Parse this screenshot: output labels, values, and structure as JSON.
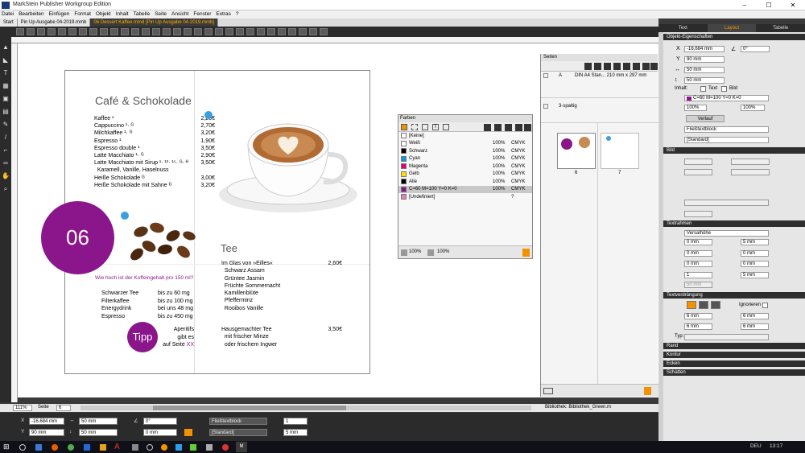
{
  "app": {
    "title": "MarkStein Publisher Workgroup Edition"
  },
  "menu": [
    "Datei",
    "Bearbeiten",
    "Einfügen",
    "Format",
    "Objekt",
    "Inhalt",
    "Tabelle",
    "Seite",
    "Ansicht",
    "Fenster",
    "Extras",
    "?"
  ],
  "tabs": [
    "Start",
    "Pin Up Ausgabe 04-2019.mmb",
    "06 Dessert Kaffee.mmd [Pin Up Ausgabe 04-2019.mmb]"
  ],
  "page": {
    "title": "Café & Schokolade",
    "coffee_items": [
      {
        "name": "Kaffee ¹",
        "price": "2,20€"
      },
      {
        "name": "Cappuccino ¹· ᴳ",
        "price": "2,70€"
      },
      {
        "name": "Milchkaffee ¹· ᴳ",
        "price": "3,20€"
      },
      {
        "name": "Espresso ¹",
        "price": "1,90€"
      },
      {
        "name": "Espresso double ¹",
        "price": "3,50€"
      },
      {
        "name": "Latte Macchiato ¹· ᴳ",
        "price": "2,90€"
      },
      {
        "name": "Latte Macchiato mit Sirup ¹· ¹³· ¹⁵· ᴳ· ᴴ",
        "price": "3,50€"
      },
      {
        "name": "  Karamell, Vanille, Haselnuss",
        "price": ""
      },
      {
        "name": "Heiße Schokolade ᴳ",
        "price": "3,00€"
      },
      {
        "name": "Heiße Schokolade mit Sahne ᴳ",
        "price": "3,20€"
      }
    ],
    "badge_number": "06",
    "caffeine_question": "Wie hoch ist der Koffeingehalt pro 150 ml?",
    "caffeine": [
      {
        "name": "Schwarzer Tee",
        "value": "bis zu 60 mg"
      },
      {
        "name": "Filterkaffee",
        "value": "bis zu 100 mg"
      },
      {
        "name": "Energydrink",
        "value": "bei uns 48 mg"
      },
      {
        "name": "Espresso",
        "value": "bis zu 450 mg"
      }
    ],
    "tipp": "Tipp",
    "tipp_text": [
      "Aperitifs",
      "gibt es",
      "auf Seite XX"
    ],
    "tea_title": "Tee",
    "tea_items": [
      {
        "name": "Im Glas von »Eilles«",
        "price": "2,60€"
      },
      {
        "name": "  Schwarz Assam",
        "price": ""
      },
      {
        "name": "  Grüntee Jasmin",
        "price": ""
      },
      {
        "name": "  Früchte Sommernacht",
        "price": ""
      },
      {
        "name": "  Kamillenblüte",
        "price": ""
      },
      {
        "name": "  Pfefferminz",
        "price": ""
      },
      {
        "name": "  Rooibos Vanille",
        "price": ""
      }
    ],
    "tea_items2": [
      {
        "name": "Hausgemachter Tee",
        "price": "3,50€"
      },
      {
        "name": "  mit frischer Minze",
        "price": ""
      },
      {
        "name": "  oder frischem Ingwer",
        "price": ""
      }
    ]
  },
  "farben": {
    "title": "Farben",
    "rows": [
      {
        "name": "[Keine]",
        "pct": "",
        "mode": "",
        "color": "#ffffff"
      },
      {
        "name": "Weiß",
        "pct": "100%",
        "mode": "CMYK",
        "color": "#ffffff"
      },
      {
        "name": "Schwarz",
        "pct": "100%",
        "mode": "CMYK",
        "color": "#000000"
      },
      {
        "name": "Cyan",
        "pct": "100%",
        "mode": "CMYK",
        "color": "#00a0e0"
      },
      {
        "name": "Magenta",
        "pct": "100%",
        "mode": "CMYK",
        "color": "#e0007a"
      },
      {
        "name": "Gelb",
        "pct": "100%",
        "mode": "CMYK",
        "color": "#ffe000"
      },
      {
        "name": "Alle",
        "pct": "100%",
        "mode": "CMYK",
        "color": "#000000"
      },
      {
        "name": "C=60 M=100 Y=0 K=0",
        "pct": "100%",
        "mode": "CMYK",
        "color": "#8b168b"
      },
      {
        "name": "[Undefiniert]",
        "pct": "",
        "mode": "?",
        "color": "#e080c0"
      }
    ],
    "footer_a": "100%",
    "footer_b": "100%"
  },
  "seiten": {
    "title": "Seiten",
    "master_a": "A",
    "master_a_desc": "DIN A4 Stan... 210 mm x 297 mm",
    "master_b": "3-spaltig",
    "page_left": "6",
    "page_right": "7"
  },
  "rpanel": {
    "tabs": [
      "Text",
      "Layout",
      "Tabelle"
    ],
    "section_objekt": "Objekt-Eigenschaften",
    "x": "-16,684 mm",
    "angle": "0°",
    "y": "90 mm",
    "w": "50 mm",
    "h": "50 mm",
    "inhalt_label": "Inhalt:",
    "inhalt_text": "Text",
    "inhalt_bild": "Bild",
    "color": "C=60 M=100 Y=0 K=0",
    "pct1": "100%",
    "pct2": "100%",
    "verlauf": "Verlauf",
    "block": "Fließtextblock",
    "standard": "[Standard]",
    "section_bild": "Bild",
    "section_textrahmen": "Textrahmen",
    "versalhoehe": "Versalhöhe",
    "zero1": "0 mm",
    "five1": "5 mm",
    "zero2": "0 mm",
    "zero3": "0 mm",
    "one": "1",
    "five2": "5 mm",
    "fifty": "50 mm",
    "section_verdraengung": "Textverdrängung",
    "ignorieren": "Ignorieren",
    "six1": "6 mm",
    "six2": "6 mm",
    "six3": "6 mm",
    "six4": "6 mm",
    "typ": "Typ:",
    "section_rand": "Rand",
    "section_kontur": "Kontur",
    "section_ecken": "Ecken",
    "section_schatten": "Schatten"
  },
  "bottom": {
    "zoom": "111%",
    "page_label": "Seite",
    "page_num": "6",
    "library": "Bibliothek: Bibliothek_Green.m"
  },
  "propbar": {
    "x": "-16,684 mm",
    "y": "90 mm",
    "w": "50 mm",
    "h": "50 mm",
    "angle": "0°",
    "zero": "0 mm",
    "block": "Fließtextblock",
    "standard": "[Standard]",
    "one": "1",
    "five": "5 mm"
  },
  "taskbar": {
    "lang": "DEU",
    "time": "13:17"
  }
}
